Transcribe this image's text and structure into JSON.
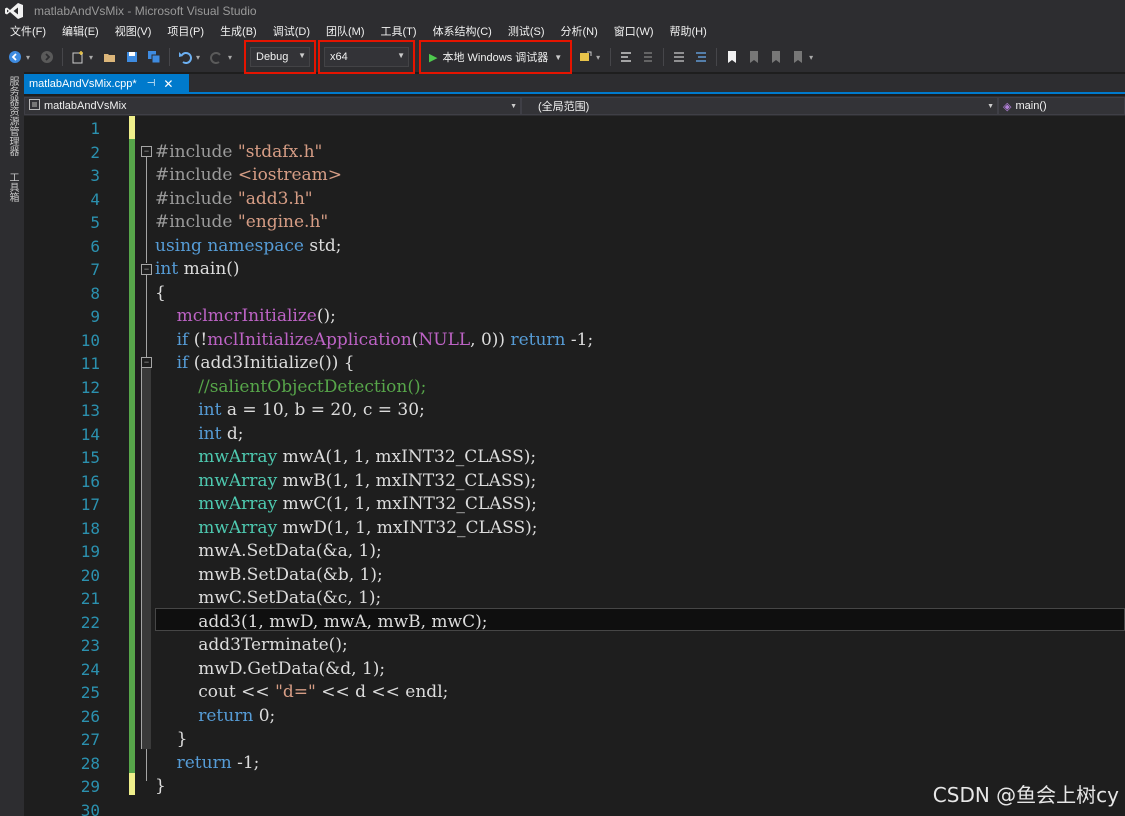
{
  "window": {
    "title": "matlabAndVsMix - Microsoft Visual Studio"
  },
  "menu": [
    "文件(F)",
    "编辑(E)",
    "视图(V)",
    "项目(P)",
    "生成(B)",
    "调试(D)",
    "团队(M)",
    "工具(T)",
    "体系结构(C)",
    "测试(S)",
    "分析(N)",
    "窗口(W)",
    "帮助(H)"
  ],
  "toolbar": {
    "configuration": "Debug",
    "platform": "x64",
    "run_label": "本地 Windows 调试器"
  },
  "side_panels": [
    "服务器资源管理器",
    "工具箱"
  ],
  "tab": {
    "filename": "matlabAndVsMix.cpp*"
  },
  "navbar": {
    "project": "matlabAndVsMix",
    "scope": "(全局范围)",
    "member": "main()"
  },
  "editor": {
    "current_line": 22,
    "lines": [
      {
        "n": "1",
        "tokens": []
      },
      {
        "n": "2",
        "tokens": [
          [
            "pp",
            "#include "
          ],
          [
            "str",
            "\"stdafx.h\""
          ]
        ]
      },
      {
        "n": "3",
        "tokens": [
          [
            "pp",
            "#include "
          ],
          [
            "str",
            "<iostream>"
          ]
        ]
      },
      {
        "n": "4",
        "tokens": [
          [
            "pp",
            "#include "
          ],
          [
            "str",
            "\"add3.h\""
          ]
        ]
      },
      {
        "n": "5",
        "tokens": [
          [
            "pp",
            "#include "
          ],
          [
            "str",
            "\"engine.h\""
          ]
        ]
      },
      {
        "n": "6",
        "tokens": [
          [
            "kw",
            "using namespace "
          ],
          [
            "",
            "std;"
          ]
        ]
      },
      {
        "n": "7",
        "tokens": [
          [
            "kw",
            "int "
          ],
          [
            "",
            "main()"
          ]
        ]
      },
      {
        "n": "8",
        "tokens": [
          [
            "",
            "{"
          ]
        ]
      },
      {
        "n": "9",
        "tokens": [
          [
            "",
            "    "
          ],
          [
            "fn",
            "mclmcrInitialize"
          ],
          [
            "",
            "();"
          ]
        ]
      },
      {
        "n": "10",
        "tokens": [
          [
            "",
            "    "
          ],
          [
            "kw",
            "if "
          ],
          [
            "",
            "(!"
          ],
          [
            "fn",
            "mclInitializeApplication"
          ],
          [
            "",
            "("
          ],
          [
            "mac",
            "NULL"
          ],
          [
            "",
            ", 0)) "
          ],
          [
            "kw",
            "return "
          ],
          [
            "",
            "-1;"
          ]
        ]
      },
      {
        "n": "11",
        "tokens": [
          [
            "",
            "    "
          ],
          [
            "kw",
            "if "
          ],
          [
            "",
            "(add3Initialize()) {"
          ]
        ]
      },
      {
        "n": "12",
        "tokens": [
          [
            "",
            "        "
          ],
          [
            "cm",
            "//salientObjectDetection();"
          ]
        ]
      },
      {
        "n": "13",
        "tokens": [
          [
            "",
            "        "
          ],
          [
            "kw",
            "int "
          ],
          [
            "",
            "a = 10, b = 20, c = 30;"
          ]
        ]
      },
      {
        "n": "14",
        "tokens": [
          [
            "",
            "        "
          ],
          [
            "kw",
            "int "
          ],
          [
            "",
            "d;"
          ]
        ]
      },
      {
        "n": "15",
        "tokens": [
          [
            "",
            "        "
          ],
          [
            "ty",
            "mwArray "
          ],
          [
            "",
            "mwA(1, 1, mxINT32_CLASS);"
          ]
        ]
      },
      {
        "n": "16",
        "tokens": [
          [
            "",
            "        "
          ],
          [
            "ty",
            "mwArray "
          ],
          [
            "",
            "mwB(1, 1, mxINT32_CLASS);"
          ]
        ]
      },
      {
        "n": "17",
        "tokens": [
          [
            "",
            "        "
          ],
          [
            "ty",
            "mwArray "
          ],
          [
            "",
            "mwC(1, 1, mxINT32_CLASS);"
          ]
        ]
      },
      {
        "n": "18",
        "tokens": [
          [
            "",
            "        "
          ],
          [
            "ty",
            "mwArray "
          ],
          [
            "",
            "mwD(1, 1, mxINT32_CLASS);"
          ]
        ]
      },
      {
        "n": "19",
        "tokens": [
          [
            "",
            "        mwA.SetData(&a, 1);"
          ]
        ]
      },
      {
        "n": "20",
        "tokens": [
          [
            "",
            "        mwB.SetData(&b, 1);"
          ]
        ]
      },
      {
        "n": "21",
        "tokens": [
          [
            "",
            "        mwC.SetData(&c, 1);"
          ]
        ]
      },
      {
        "n": "22",
        "tokens": [
          [
            "",
            "        add3(1, mwD, mwA, mwB, mwC);"
          ]
        ]
      },
      {
        "n": "23",
        "tokens": [
          [
            "",
            "        add3Terminate();"
          ]
        ]
      },
      {
        "n": "24",
        "tokens": [
          [
            "",
            "        mwD.GetData(&d, 1);"
          ]
        ]
      },
      {
        "n": "25",
        "tokens": [
          [
            "",
            "        cout << "
          ],
          [
            "str",
            "\"d=\""
          ],
          [
            "",
            " << d << endl;"
          ]
        ]
      },
      {
        "n": "26",
        "tokens": [
          [
            "",
            "        "
          ],
          [
            "kw",
            "return "
          ],
          [
            "",
            "0;"
          ]
        ]
      },
      {
        "n": "27",
        "tokens": [
          [
            "",
            "    }"
          ]
        ]
      },
      {
        "n": "28",
        "tokens": [
          [
            "",
            "    "
          ],
          [
            "kw",
            "return "
          ],
          [
            "",
            "-1;"
          ]
        ]
      },
      {
        "n": "29",
        "tokens": [
          [
            "",
            "}"
          ]
        ]
      },
      {
        "n": "30",
        "tokens": []
      }
    ]
  },
  "watermark": "CSDN @鱼会上树cy",
  "colors": {
    "accent": "#007acc",
    "highlight_box": "#e51400",
    "line_number": "#2b91af"
  }
}
